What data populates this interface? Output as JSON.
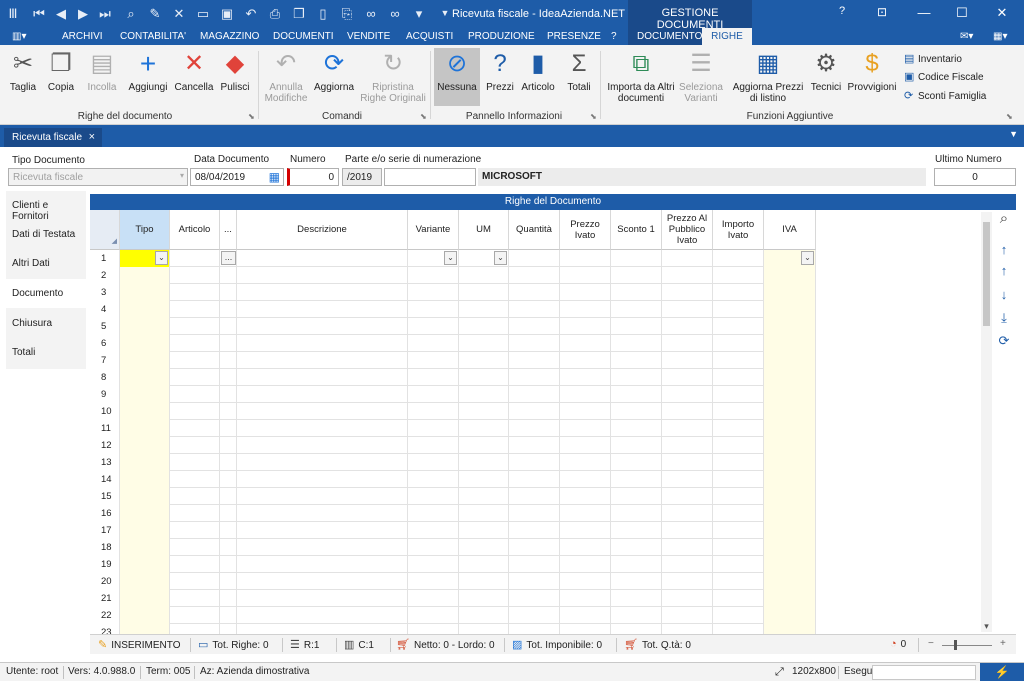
{
  "titlebar": {
    "title": "Ricevuta fiscale - IdeaAzienda.NET - Sm...",
    "context_header": "GESTIONE DOCUMENTI",
    "help_glyph": "?",
    "quick_access_icons": [
      "app-icon",
      "first-icon",
      "prev-icon",
      "next-icon",
      "last-icon",
      "search-icon",
      "edit-icon",
      "delete-icon",
      "open-icon",
      "save-icon",
      "undo-icon",
      "print-icon",
      "copy-icon",
      "attach-icon",
      "binoculars-icon",
      "binoculars2-icon",
      "dropdown-icon"
    ]
  },
  "menu": {
    "items": [
      "ARCHIVI",
      "CONTABILITA'",
      "MAGAZZINO",
      "DOCUMENTI",
      "VENDITE",
      "ACQUISTI",
      "PRODUZIONE",
      "PRESENZE",
      "?",
      "DOCUMENTO"
    ],
    "active_tab": "RIGHE"
  },
  "ribbon": {
    "groups": {
      "righe": "Righe del documento",
      "comandi": "Comandi",
      "pannello": "Pannello Informazioni",
      "funzioni": "Funzioni Aggiuntive"
    },
    "buttons": {
      "taglia": "Taglia",
      "copia": "Copia",
      "incolla": "Incolla",
      "aggiungi": "Aggiungi",
      "cancella": "Cancella",
      "pulisci": "Pulisci",
      "annulla": "Annulla Modifiche",
      "aggiorna": "Aggiorna",
      "ripristina": "Ripristina Righe Originali",
      "nessuna": "Nessuna",
      "prezzi": "Prezzi",
      "articolo": "Articolo",
      "totali": "Totali",
      "importa": "Importa da Altri documenti",
      "seleziona": "Seleziona Varianti",
      "aggiorna_prezzi": "Aggiorna Prezzi di listino",
      "tecnici": "Tecnici",
      "provvigioni": "Provvigioni",
      "inventario": "Inventario",
      "codice_fiscale": "Codice Fiscale",
      "sconti_famiglia": "Sconti Famiglia"
    }
  },
  "doc_tab": {
    "label": "Ricevuta fiscale",
    "close": "×"
  },
  "header": {
    "tipo_documento_label": "Tipo Documento",
    "tipo_documento_value": "Ricevuta fiscale",
    "data_documento_label": "Data Documento",
    "data_documento_value": "08/04/2019",
    "numero_label": "Numero",
    "numero_value": "0",
    "serie_label": "Parte e/o serie di numerazione",
    "serie_value": "/2019",
    "serie_extra": "",
    "company": "MICROSOFT",
    "ultimo_numero_label": "Ultimo Numero",
    "ultimo_numero_value": "0"
  },
  "side_tabs": [
    "Clienti e Fornitori",
    "Dati di Testata",
    "Altri Dati",
    "Documento",
    "Chiusura",
    "Totali"
  ],
  "side_tabs_active": "Documento",
  "grid": {
    "title": "Righe del Documento",
    "columns": [
      "Tipo",
      "Articolo",
      "...",
      "Descrizione",
      "Variante",
      "UM",
      "Quantità",
      "Prezzo Ivato",
      "Sconto 1",
      "Prezzo Al Pubblico Ivato",
      "Importo Ivato",
      "IVA"
    ],
    "row_numbers": [
      "1",
      "2",
      "3",
      "4",
      "5",
      "6",
      "7",
      "8",
      "9",
      "10",
      "11",
      "12",
      "13",
      "14",
      "15",
      "16",
      "17",
      "18",
      "19",
      "20",
      "21",
      "22",
      "23"
    ]
  },
  "grid_status": {
    "mode": "INSERIMENTO",
    "tot_righe": "Tot. Righe: 0",
    "riga": "R:1",
    "colonna": "C:1",
    "netto_lordo": "Netto: 0 - Lordo: 0",
    "imponibile": "Tot. Imponibile: 0",
    "quantita": "Tot. Q.tà: 0",
    "zoom_count": "0"
  },
  "statusbar": {
    "utente": "Utente: root",
    "versione": "Vers: 4.0.988.0",
    "terminale": "Term: 005",
    "azienda": "Az: Azienda dimostrativa",
    "risoluzione": "1202x800",
    "esegui": "Esegui"
  },
  "colors": {
    "brand_blue": "#1e5ca8",
    "context_blue": "#1a4a8a",
    "ribbon_bg": "#f3f3f3",
    "selected_cell": "#ffff00",
    "column_highlight": "#fffde6",
    "header_highlight": "#c8e0f6"
  }
}
